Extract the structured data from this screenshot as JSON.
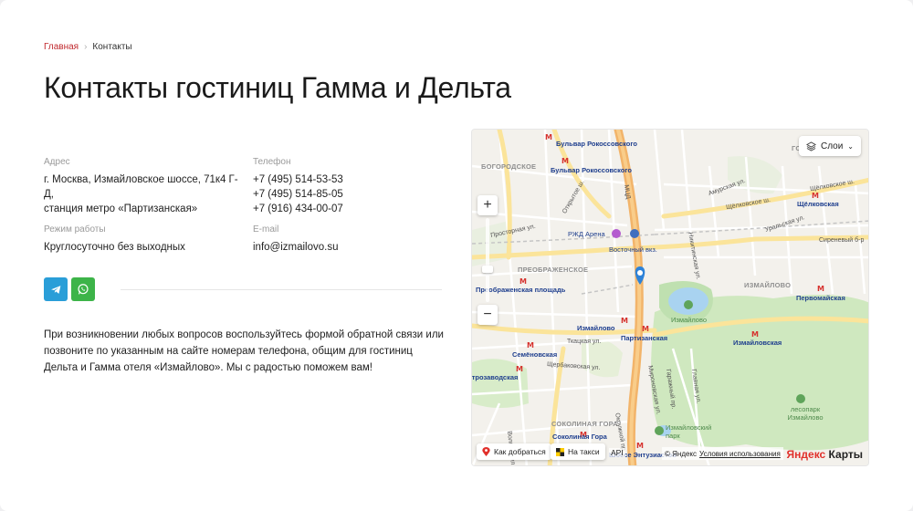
{
  "breadcrumb": {
    "home": "Главная",
    "current": "Контакты"
  },
  "page_title": "Контакты гостиниц Гамма и Дельта",
  "address": {
    "label": "Адрес",
    "line1": "г. Москва, Измайловское шоссе, 71к4 Г-",
    "line2": "Д,",
    "line3": "станция метро «Партизанская»"
  },
  "phone": {
    "label": "Телефон",
    "numbers": [
      "+7 (495) 514-53-53",
      "+7 (495) 514-85-05",
      "+7 (916) 434-00-07"
    ]
  },
  "hours": {
    "label": "Режим работы",
    "value": "Круглосуточно без выходных"
  },
  "email": {
    "label": "E-mail",
    "value": "info@izmailovo.su"
  },
  "socials": {
    "telegram_color": "#2a9ed8",
    "whatsapp_color": "#3db449"
  },
  "description": {
    "line1": "При возникновении любых вопросов воспользуйтесь формой обратной связи или",
    "line2": "позвоните по указанным на сайте номерам телефона, общим для гостиниц",
    "line3": "Дельта и Гамма отеля «Измайлово». Мы с радостью поможем вам!"
  },
  "map": {
    "layers_label": "Слои",
    "zoom_in": "+",
    "zoom_out": "−",
    "route_label": "Как добраться",
    "taxi_label": "На такси",
    "api_label": "API",
    "copyright": "© Яндекс",
    "terms": "Условия использования",
    "logo_ya": "Яндекс",
    "logo_maps": " Карты",
    "metro_stations": [
      "Бульвар Рокоссовского",
      "Бульвар Рокоссовского",
      "Щёлковская",
      "Первомайская",
      "Измайловская",
      "Партизанская",
      "Измайлово",
      "Семёновская",
      "Преображенская площадь",
      "Электрозаводская",
      "Соколиная Гора",
      "Шоссе Энтузиастов"
    ],
    "districts": [
      "БОГОРОДСКОЕ",
      "ПРЕОБРАЖЕНСКОЕ",
      "ИЗМАЙЛОВО",
      "СОКОЛИНАЯ ГОРА",
      "ГОЛЬ"
    ],
    "streets": [
      "МЦД",
      "Щёлковское ш.",
      "Щёлковское ш.",
      "Амурская ул.",
      "Уральская ул.",
      "Никитинская ул.",
      "Сиреневый б-р",
      "Просторная ул.",
      "Открытое ш.",
      "Ткацкая ул.",
      "Щербаковская ул.",
      "Окружной пр.",
      "Вольная ул.",
      "Мироновская ул.",
      "Гаражный пр.",
      "Главная ул."
    ],
    "places": [
      "РЖД Арена",
      "Восточный вкз.",
      "Измайлово",
      "Измайловский парк",
      "лесопарк Измайлово"
    ]
  }
}
